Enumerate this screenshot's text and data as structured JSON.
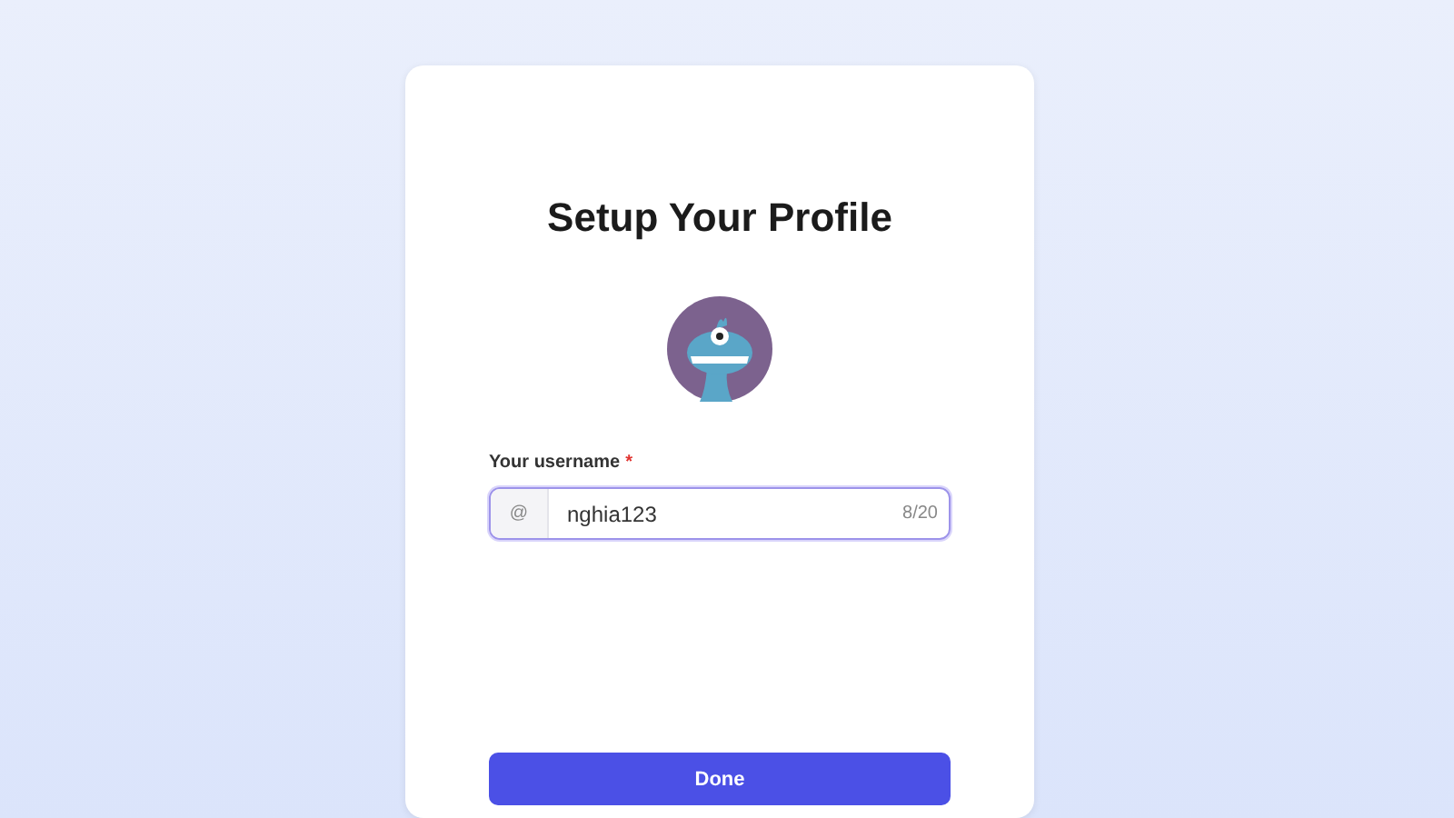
{
  "title": "Setup Your Profile",
  "username_field": {
    "label": "Your username",
    "required_mark": "*",
    "prefix": "@",
    "value": "nghia123",
    "counter": "8/20",
    "focused": true
  },
  "buttons": [
    "Done"
  ]
}
